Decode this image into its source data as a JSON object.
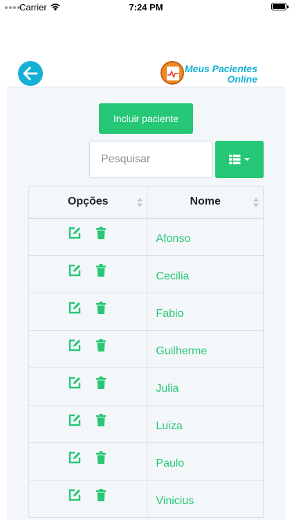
{
  "status_bar": {
    "carrier": "Carrier",
    "time": "7:24 PM"
  },
  "header": {
    "logo_line1": "Meus Pacientes",
    "logo_line2": "Online"
  },
  "actions": {
    "add_patient_label": "Incluir paciente",
    "search_placeholder": "Pesquisar"
  },
  "table": {
    "columns": [
      "Opções",
      "Nome"
    ],
    "rows": [
      "Afonso",
      "Cecilia",
      "Fabio",
      "Guilherme",
      "Julia",
      "Luiza",
      "Paulo",
      "Vinicius"
    ]
  },
  "colors": {
    "accent": "#26c776",
    "brand": "#14b0d6",
    "logo": "#f08a24"
  },
  "icons": [
    "back-arrow-icon",
    "wifi-icon",
    "battery-icon",
    "list-icon",
    "caret-down-icon",
    "edit-icon",
    "trash-icon",
    "sort-icon"
  ]
}
